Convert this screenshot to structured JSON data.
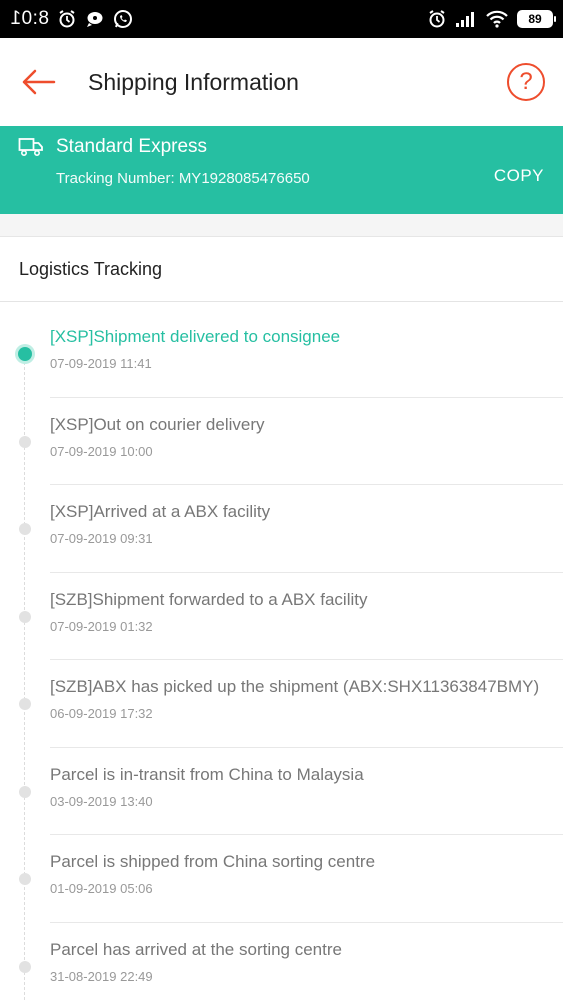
{
  "status_bar": {
    "time": "8:01",
    "battery": "89",
    "icons": [
      "alarm-icon",
      "chat-bubble-icon",
      "whatsapp-icon",
      "alarm-icon",
      "signal-icon",
      "wifi-icon",
      "battery-icon"
    ]
  },
  "header": {
    "title": "Shipping Information",
    "help_label": "?"
  },
  "shipping": {
    "method": "Standard Express",
    "tracking": "Tracking Number: MY1928085476650",
    "copy_label": "COPY"
  },
  "logistics": {
    "title": "Logistics Tracking",
    "events": [
      {
        "text": "[XSP]Shipment delivered to consignee",
        "time": "07-09-2019 11:41",
        "active": true
      },
      {
        "text": "[XSP]Out on courier delivery",
        "time": "07-09-2019 10:00",
        "active": false
      },
      {
        "text": "[XSP]Arrived at a ABX facility",
        "time": "07-09-2019 09:31",
        "active": false
      },
      {
        "text": "[SZB]Shipment forwarded to a ABX facility",
        "time": "07-09-2019 01:32",
        "active": false
      },
      {
        "text": "[SZB]ABX has picked up the shipment (ABX:SHX11363847BMY)",
        "time": "06-09-2019 17:32",
        "active": false
      },
      {
        "text": "Parcel is in-transit from China to Malaysia",
        "time": "03-09-2019 13:40",
        "active": false
      },
      {
        "text": "Parcel is shipped from China sorting centre",
        "time": "01-09-2019 05:06",
        "active": false
      },
      {
        "text": "Parcel has arrived at the sorting centre",
        "time": "31-08-2019 22:49",
        "active": false
      }
    ]
  },
  "colors": {
    "accent": "#ee4d2d",
    "teal": "#26bfa2"
  }
}
